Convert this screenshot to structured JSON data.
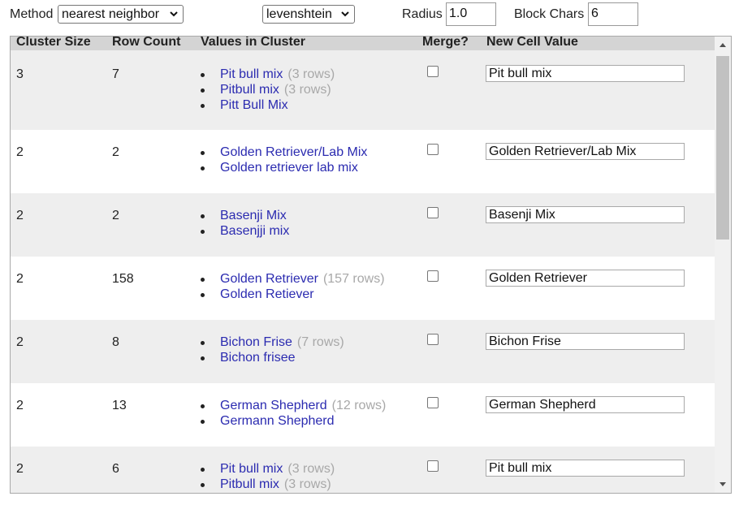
{
  "toolbar": {
    "method_label": "Method",
    "method_value": "nearest neighbor",
    "distance_value": "levenshtein",
    "radius_label": "Radius",
    "radius_value": "1.0",
    "block_chars_label": "Block Chars",
    "block_chars_value": "6"
  },
  "table": {
    "headers": {
      "cluster_size": "Cluster Size",
      "row_count": "Row Count",
      "values": "Values in Cluster",
      "merge": "Merge?",
      "new_value": "New Cell Value"
    },
    "rows": [
      {
        "cluster_size": "3",
        "row_count": "7",
        "values": [
          {
            "text": "Pit bull mix",
            "count": "(3 rows)"
          },
          {
            "text": "Pitbull mix",
            "count": "(3 rows)"
          },
          {
            "text": "Pitt Bull Mix",
            "count": ""
          }
        ],
        "merge": false,
        "new_value": "Pit bull mix"
      },
      {
        "cluster_size": "2",
        "row_count": "2",
        "values": [
          {
            "text": "Golden Retriever/Lab Mix",
            "count": ""
          },
          {
            "text": "Golden retriever lab mix",
            "count": ""
          }
        ],
        "merge": false,
        "new_value": "Golden Retriever/Lab Mix"
      },
      {
        "cluster_size": "2",
        "row_count": "2",
        "values": [
          {
            "text": "Basenji Mix",
            "count": ""
          },
          {
            "text": "Basenjji mix",
            "count": ""
          }
        ],
        "merge": false,
        "new_value": "Basenji Mix"
      },
      {
        "cluster_size": "2",
        "row_count": "158",
        "values": [
          {
            "text": "Golden Retriever",
            "count": "(157 rows)"
          },
          {
            "text": "Golden Retiever",
            "count": ""
          }
        ],
        "merge": false,
        "new_value": "Golden Retriever"
      },
      {
        "cluster_size": "2",
        "row_count": "8",
        "values": [
          {
            "text": "Bichon Frise",
            "count": "(7 rows)"
          },
          {
            "text": "Bichon frisee",
            "count": ""
          }
        ],
        "merge": false,
        "new_value": "Bichon Frise"
      },
      {
        "cluster_size": "2",
        "row_count": "13",
        "values": [
          {
            "text": "German Shepherd",
            "count": "(12 rows)"
          },
          {
            "text": "Germann Shepherd",
            "count": ""
          }
        ],
        "merge": false,
        "new_value": "German Shepherd"
      },
      {
        "cluster_size": "2",
        "row_count": "6",
        "values": [
          {
            "text": "Pit bull mix",
            "count": "(3 rows)"
          },
          {
            "text": "Pitbull mix",
            "count": "(3 rows)"
          }
        ],
        "merge": false,
        "new_value": "Pit bull mix"
      }
    ]
  },
  "icons": {
    "dropdown": "chevron-down-icon",
    "scroll_up": "triangle-up-icon",
    "scroll_down": "triangle-down-icon"
  },
  "colors": {
    "value_link": "#2b2bb0",
    "row_count_hint": "#a8a8a8",
    "header_bg": "#d4d4d4",
    "row_alt_bg": "#eeeeee"
  }
}
